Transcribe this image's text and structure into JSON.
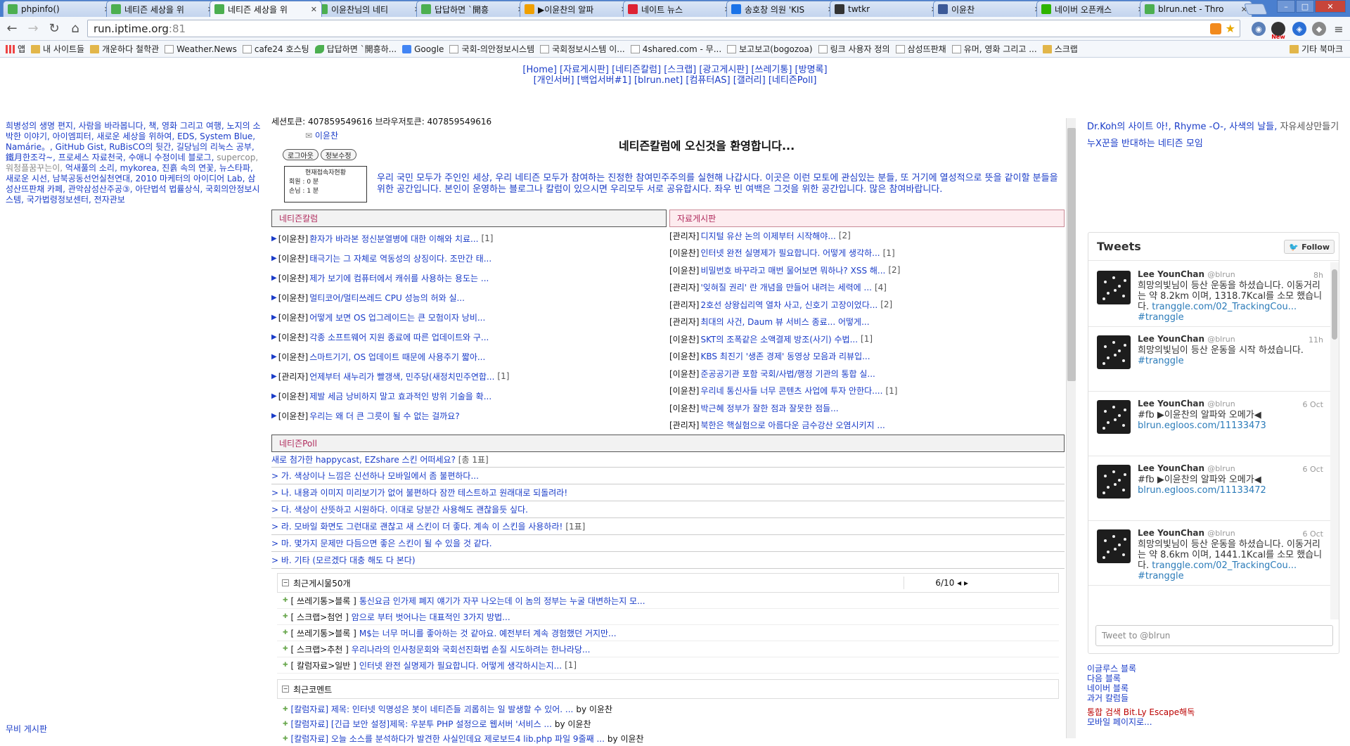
{
  "tabs": [
    {
      "title": "phpinfo()",
      "fav": "#4caf50",
      "favicon": "leaf-icon"
    },
    {
      "title": "네티즌 세상을 위",
      "fav": "#4caf50",
      "favicon": "leaf-icon"
    },
    {
      "title": "네티즌 세상을 위",
      "fav": "#4caf50",
      "favicon": "leaf-icon",
      "active": true
    },
    {
      "title": "이윤찬님의 네티",
      "fav": "#4caf50",
      "favicon": "leaf-icon"
    },
    {
      "title": "답답하면 `開흥",
      "fav": "#4caf50",
      "favicon": "leaf-icon"
    },
    {
      "title": "▶이윤찬의 알파",
      "fav": "#f0a000",
      "favicon": "bulb-icon"
    },
    {
      "title": "네이트 뉴스",
      "fav": "#d23",
      "favicon": "nate-icon"
    },
    {
      "title": "송호창 의원 'KIS",
      "fav": "#1a73e8",
      "favicon": "z-icon"
    },
    {
      "title": "twtkr",
      "fav": "#333",
      "favicon": "twtkr-icon"
    },
    {
      "title": "이윤찬",
      "fav": "#3b5998",
      "favicon": "facebook-icon"
    },
    {
      "title": "네이버 오픈캐스",
      "fav": "#2db400",
      "favicon": "naver-icon"
    },
    {
      "title": "blrun.net - Thro",
      "fav": "#4caf50",
      "favicon": "leaf-icon"
    }
  ],
  "toolbar": {
    "url_host": "run.iptime.org",
    "url_port": ":81",
    "badge": "New"
  },
  "bookmarks": [
    {
      "label": "앱",
      "icon": "apps-icon"
    },
    {
      "label": "내 사이트들",
      "icon": "folder-icon"
    },
    {
      "label": "개운하다 철학관",
      "icon": "folder-icon"
    },
    {
      "label": "Weather.News",
      "icon": "page-icon"
    },
    {
      "label": "cafe24 호스팅",
      "icon": "page-icon"
    },
    {
      "label": "답답하면 `開흥하...",
      "icon": "leaf-icon"
    },
    {
      "label": "Google",
      "icon": "google-icon"
    },
    {
      "label": "국회-의안정보시스템",
      "icon": "page-icon"
    },
    {
      "label": "국회정보시스템 이...",
      "icon": "page-icon"
    },
    {
      "label": "4shared.com - 무...",
      "icon": "page-icon"
    },
    {
      "label": "보고보고(bogozoa)",
      "icon": "page-icon"
    },
    {
      "label": "링크 사용자 정의",
      "icon": "page-icon"
    },
    {
      "label": "삼성뜨판채",
      "icon": "page-icon"
    },
    {
      "label": "유머, 영화 그리고 ...",
      "icon": "page-icon"
    },
    {
      "label": "스크랩",
      "icon": "folder-icon"
    },
    {
      "label": "기타 북마크",
      "icon": "folder-icon"
    }
  ],
  "topnav": {
    "line1": "[Home] [자료게시판] [네티즌칼럼] [스크랩] [광고게시판] [쓰레기통] [방명록]",
    "line2": "[개인서버] [백업서버#1] [blrun.net] [컴퓨터AS] [갤러리] [네티즌Poll]"
  },
  "left": {
    "text": "희병성의 생명 편지, 사람을 바라봅니다, 책, 영화 그리고 여행, 노지의 소박한 이야기, 아이엠피터, 새로운 세상을 위하여, EDS, System Blue, Namárie。, GitHub Gist, RuBisCO의 뒷간, 길당님의 리눅스 공부, 鐵月한조각~, 프로세스 자료천국, 수애니 수정이네 블로그, ",
    "gray": "supercop, 워청플꿈꾸는이, ",
    "text2": "억새풀의 소리, mykorea, 진흙 속의 연꽃, 뉴스타파, 새로운 시선, 남북공동선언실천연대, 2010 마케터의 아이디어 Lab, 삼성산뜨판채 카페, 관악삼성산주공③, 아단법석 법률상식, 국회의안정보시스템, 국가법령정보센터, 전자관보",
    "bottom": "무비 게시판"
  },
  "main": {
    "tokens": "세션토큰: 407859549616 브라우저토큰: 407859549616",
    "user": "이윤찬",
    "logout": "로그아웃",
    "edit": "정보수정",
    "stats_title": "현재접속자현황",
    "stats_member": "회원 :  0 분",
    "stats_guest": "손님 :  1 분",
    "welcome": "네티즌칼럼에 오신것을 환영합니다...",
    "intro": "우리 국민 모두가 주인인 세상, 우리 네티즌 모두가 참여하는 진정한 참여민주주의를 실현해 나갑시다. 이곳은 이런 모토에 관심있는 분들, 또 거기에 열성적으로 뜻을 같이할 분들을 위한 공간입니다. 본인이 운영하는 블로그나 칼럼이 있으시면 우리모두 서로 공유합시다. 좌우 빈 여백은 그것을 위한 공간입니다. 많은 참여바랍니다.",
    "column_header": "네티즌칼럼",
    "columns": [
      {
        "author": "[이윤찬]",
        "title": "환자가 바라본 정신분열병에 대한 이해와 치료...",
        "count": "[1]"
      },
      {
        "author": "[이윤찬]",
        "title": "태극기는 그 자체로 역동성의 상징이다. 조만간 태...",
        "count": ""
      },
      {
        "author": "[이윤찬]",
        "title": "제가 보기에 컴퓨터에서 캐쉬를 사용하는 용도는 ...",
        "count": ""
      },
      {
        "author": "[이윤찬]",
        "title": "멀티코어/멀티쓰레드 CPU 성능의 허와 실...",
        "count": ""
      },
      {
        "author": "[이윤찬]",
        "title": "어떻게 보면 OS 업그레이드는 큰 모험이자 낭비...",
        "count": ""
      },
      {
        "author": "[이윤찬]",
        "title": "각종 소프트웨어 지원 종료에 따른 업데이트와 구...",
        "count": ""
      },
      {
        "author": "[이윤찬]",
        "title": "스마트기기, OS 업데이트 때문에 사용주기 짧아...",
        "count": ""
      },
      {
        "author": "[관리자]",
        "title": "언제부터 새누리가 빨갱색, 민주당(새정치민주연합...",
        "count": "[1]"
      },
      {
        "author": "[이윤찬]",
        "title": "제발 세금 낭비하지 말고 효과적인 방위 기술을 확...",
        "count": ""
      },
      {
        "author": "[이윤찬]",
        "title": "우리는 왜 더 큰 그릇이 될 수 없는 걸까요?",
        "count": ""
      }
    ],
    "archive_header": "자료게시판",
    "archive": [
      {
        "author": "[관리자]",
        "title": "디지털 유산 논의 이제부터 시작해야...",
        "count": "[2]"
      },
      {
        "author": "[이윤찬]",
        "title": "인터넷 완전 실명제가 필요합니다. 어떻게 생각하...",
        "count": "[1]"
      },
      {
        "author": "[이윤찬]",
        "title": "비밀번호 바꾸라고 매번 물어보면 뭐하나? XSS 해...",
        "count": "[2]"
      },
      {
        "author": "[관리자]",
        "title": "'잊혀질 권리' 란 개념을 만들어 내려는 세력에 ...",
        "count": "[4]"
      },
      {
        "author": "[관리자]",
        "title": "2호선 상왕십리역 열차 사고, 신호기 고장이었다...",
        "count": "[2]"
      },
      {
        "author": "[관리자]",
        "title": "최대의 사건, Daum 뷰 서비스 종료... 어떻게...",
        "count": ""
      },
      {
        "author": "[이윤찬]",
        "title": "SKT의 조폭같은 소액결제 방조(사기) 수법...",
        "count": "[1]"
      },
      {
        "author": "[이윤찬]",
        "title": "KBS 최진기 '생존 경제' 동영상 모음과 리뷰입...",
        "count": ""
      },
      {
        "author": "[이윤찬]",
        "title": "준공공기관 포함 국회/사법/행정 기관의 통합 실...",
        "count": ""
      },
      {
        "author": "[이윤찬]",
        "title": "우리네 통신사들 너무 콘텐츠 사업에 투자 안한다....",
        "count": "[1]"
      },
      {
        "author": "[이윤찬]",
        "title": "박근혜 정부가 잘한 점과 잘못한 점들...",
        "count": ""
      },
      {
        "author": "[관리자]",
        "title": "북한은 핵실험으로 아름다운 금수강산 오염시키지 ...",
        "count": ""
      }
    ],
    "poll_header": "네티즌Poll",
    "poll_question": "새로 첨가한 happycast, EZshare 스킨 어떠세요?",
    "poll_total": "[총 1표]",
    "poll_options": [
      {
        "text": "> 가. 색상이나 느낌은 신선하나 모바일에서 좀 불편하다...",
        "votes": ""
      },
      {
        "text": "> 나. 내용과 이미지 미리보기가 없어 불편하다 잠깐 테스트하고 원래대로 되돌려라!",
        "votes": ""
      },
      {
        "text": "> 다. 색상이 산뜻하고 시원하다. 이대로 당분간 사용해도 괜찮을듯 싶다.",
        "votes": ""
      },
      {
        "text": "> 라. 모바일 화면도 그런대로 괜찮고 새 스킨이 더 좋다. 계속 이 스킨을 사용하라!",
        "votes": "[1표]"
      },
      {
        "text": "> 마. 몇가지 문제만 다듬으면 좋은 스킨이 될 수 있을 것 같다.",
        "votes": ""
      },
      {
        "text": "> 바. 기타 (모르겠다 대충 해도 다 본다)",
        "votes": ""
      }
    ],
    "recent_header": "최근게시물50개",
    "pager": "6/10 ◂ ▸",
    "recent": [
      {
        "cat": "[ 쓰레기통>블록 ]",
        "title": "통신요금 인가제 폐지 얘기가 자꾸 나오는데 이 놈의 정부는 누굴 대변하는지 모...",
        "count": ""
      },
      {
        "cat": "[ 스크랩>첨언 ]",
        "title": "암으로 부터 벗어나는 대표적인 3가지 방법...",
        "count": ""
      },
      {
        "cat": "[ 쓰레기통>블록 ]",
        "title": "M$는 너무 머니를 좋아하는 것 같아요. 예전부터 계속 경험했던 거지만...",
        "count": ""
      },
      {
        "cat": "[ 스크랩>추천 ]",
        "title": "우리나라의 인사청문회와 국회선진화법 손질 시도하려는 한나라당...",
        "count": ""
      },
      {
        "cat": "[ 칼럼자료>일반 ]",
        "title": "인터넷 완전 실명제가 필요합니다. 어떻게 생각하시는지...",
        "count": "[1]"
      }
    ],
    "comments_header": "최근코멘트",
    "comments": [
      {
        "text": "[칼럼자료] 제목: 인터넷 익명성은 봇이 네티즌들 괴롭히는 일 발생할 수 있어. ...",
        "by": "by 이윤찬"
      },
      {
        "text": "[칼럼자료] [긴급 보안 설정]제목: 우분투 PHP 설정으로 웹서버 '서비스 ...",
        "by": "by 이윤찬"
      },
      {
        "text": "[칼럼자료] 오늘 소스를 분석하다가 발견한 사실인데요 제로보드4 lib.php 파일 9줄째 ...",
        "by": "by 이윤찬"
      }
    ]
  },
  "right": {
    "links": "Dr.Koh의 사이트 아!, Rhyme -O-, 사색의 날들, ",
    "links_gray": "자유세상만들기",
    "link2": "누X꾼을 반대하는 네티즌 모임",
    "tweets_title": "Tweets",
    "follow": "Follow",
    "tweet_input": "Tweet to @blrun",
    "tweets": [
      {
        "name": "Lee YounChan",
        "handle": "@blrun",
        "time": "8h",
        "text": "희망의빛님이 등산 운동을 하셨습니다. 이동거리는 약 8.2km 이며, 1318.7Kcal를 소모 했습니다.",
        "link": "tranggle.com/02_TrackingCou... #tranggle"
      },
      {
        "name": "Lee YounChan",
        "handle": "@blrun",
        "time": "11h",
        "text": "희망의빛님이 등산 운동을 시작 하셨습니다.",
        "link": "#tranggle"
      },
      {
        "name": "Lee YounChan",
        "handle": "@blrun",
        "time": "6 Oct",
        "text": "#fb ▶이윤찬의 알파와 오메가◀",
        "link": "blrun.egloos.com/11133473"
      },
      {
        "name": "Lee YounChan",
        "handle": "@blrun",
        "time": "6 Oct",
        "text": "#fb ▶이윤찬의 알파와 오메가◀",
        "link": "blrun.egloos.com/11133472"
      },
      {
        "name": "Lee YounChan",
        "handle": "@blrun",
        "time": "6 Oct",
        "text": "희망의빛님이 등산 운동을 하셨습니다. 이동거리는 약 8.6km 이며, 1441.1Kcal를 소모 했습니다.",
        "link": "tranggle.com/02_TrackingCou... #tranggle"
      }
    ],
    "bottom": [
      "이글루스 블록",
      "다음 블록",
      "네이버 블록",
      "과거 칼럼들"
    ],
    "bottom_red": "통합 검색 Bit.Ly Escape해독",
    "bottom_last": "모바일 페이지로..."
  }
}
